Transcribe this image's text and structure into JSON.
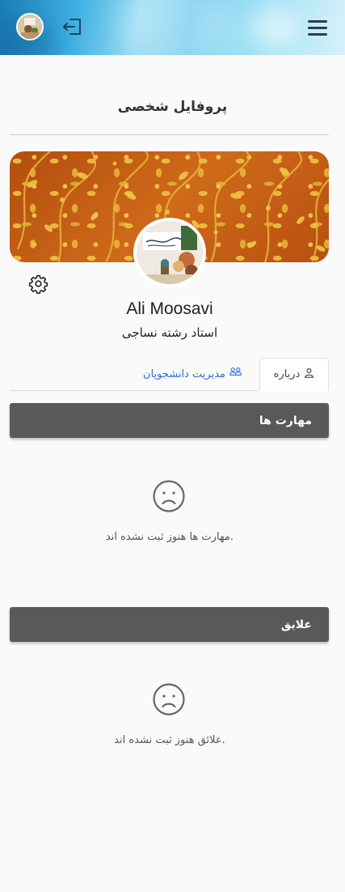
{
  "header": {
    "menu_icon": "hamburger-icon",
    "logout_icon": "logout-icon",
    "avatar": "user-avatar"
  },
  "page": {
    "title": "پروفایل شخصی"
  },
  "profile": {
    "name": "Ali Moosavi",
    "role": "استاد رشته نساجی",
    "settings_icon": "gear-icon"
  },
  "tabs": [
    {
      "label": "درباره",
      "icon": "user-icon",
      "active": true
    },
    {
      "label": "مدیریت دانشجویان",
      "icon": "users-icon",
      "active": false
    }
  ],
  "sections": [
    {
      "title": "مهارت ها",
      "empty_text": "مهارت ها هنوز ثبت نشده اند.",
      "icon": "sad-face-icon"
    },
    {
      "title": "علایق",
      "empty_text": "علائق هنوز ثبت نشده اند.",
      "icon": "sad-face-icon"
    }
  ],
  "colors": {
    "accent": "#2e6fd6",
    "section_header": "#595959",
    "cover": "#c25a12"
  }
}
